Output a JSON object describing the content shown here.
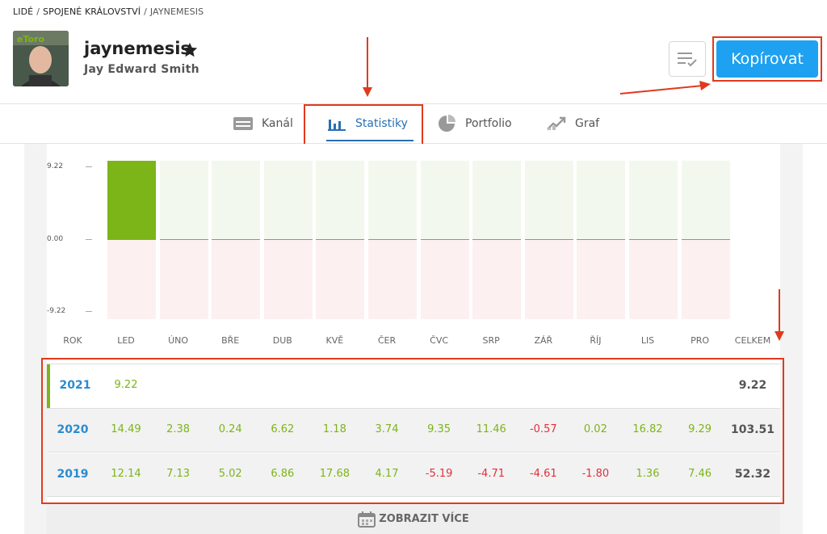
{
  "breadcrumb": [
    {
      "label": "LIDÉ"
    },
    {
      "label": "SPOJENÉ KRÁLOVSTVÍ"
    },
    {
      "label": "JAYNEMESIS"
    }
  ],
  "profile": {
    "username": "jaynemesis",
    "full_name": "Jay Edward Smith",
    "avatar_badge": "eToro"
  },
  "actions": {
    "copy_label": "Kopírovat"
  },
  "tabs": [
    {
      "label": "Kanál",
      "icon": "feed-icon",
      "active": false
    },
    {
      "label": "Statistiky",
      "icon": "bar-chart-icon",
      "active": true
    },
    {
      "label": "Portfolio",
      "icon": "pie-chart-icon",
      "active": false
    },
    {
      "label": "Graf",
      "icon": "trend-chart-icon",
      "active": false
    }
  ],
  "chart_data": {
    "type": "bar",
    "y_ticks": [
      "9.22",
      "0.00",
      "-9.22"
    ],
    "ylim": [
      -9.22,
      9.22
    ],
    "categories": [
      "LED",
      "ÚNO",
      "BŘE",
      "DUB",
      "KVĚ",
      "ČER",
      "ČVC",
      "SRP",
      "ZÁŘ",
      "ŘÍJ",
      "LIS",
      "PRO"
    ],
    "series": [
      {
        "values": [
          9.22,
          0,
          0,
          0,
          0,
          0,
          0,
          0,
          0,
          0,
          0,
          0
        ]
      }
    ]
  },
  "table": {
    "year_header": "ROK",
    "total_header": "CELKEM",
    "months": [
      "LED",
      "ÚNO",
      "BŘE",
      "DUB",
      "KVĚ",
      "ČER",
      "ČVC",
      "SRP",
      "ZÁŘ",
      "ŘÍJ",
      "LIS",
      "PRO"
    ],
    "rows": [
      {
        "year": "2021",
        "values": [
          "9.22",
          "",
          "",
          "",
          "",
          "",
          "",
          "",
          "",
          "",
          "",
          ""
        ],
        "total": "9.22"
      },
      {
        "year": "2020",
        "values": [
          "14.49",
          "2.38",
          "0.24",
          "6.62",
          "1.18",
          "3.74",
          "9.35",
          "11.46",
          "-0.57",
          "0.02",
          "16.82",
          "9.29"
        ],
        "total": "103.51"
      },
      {
        "year": "2019",
        "values": [
          "12.14",
          "7.13",
          "5.02",
          "6.86",
          "17.68",
          "4.17",
          "-5.19",
          "-4.71",
          "-4.61",
          "-1.80",
          "1.36",
          "7.46"
        ],
        "total": "52.32"
      }
    ]
  },
  "more_label": "ZOBRAZIT VÍCE",
  "colors": {
    "accent": "#1ea1f1",
    "positive": "#7cb518",
    "negative": "#e0303a",
    "year": "#2a8bd1",
    "highlight": "#e03a1e"
  }
}
